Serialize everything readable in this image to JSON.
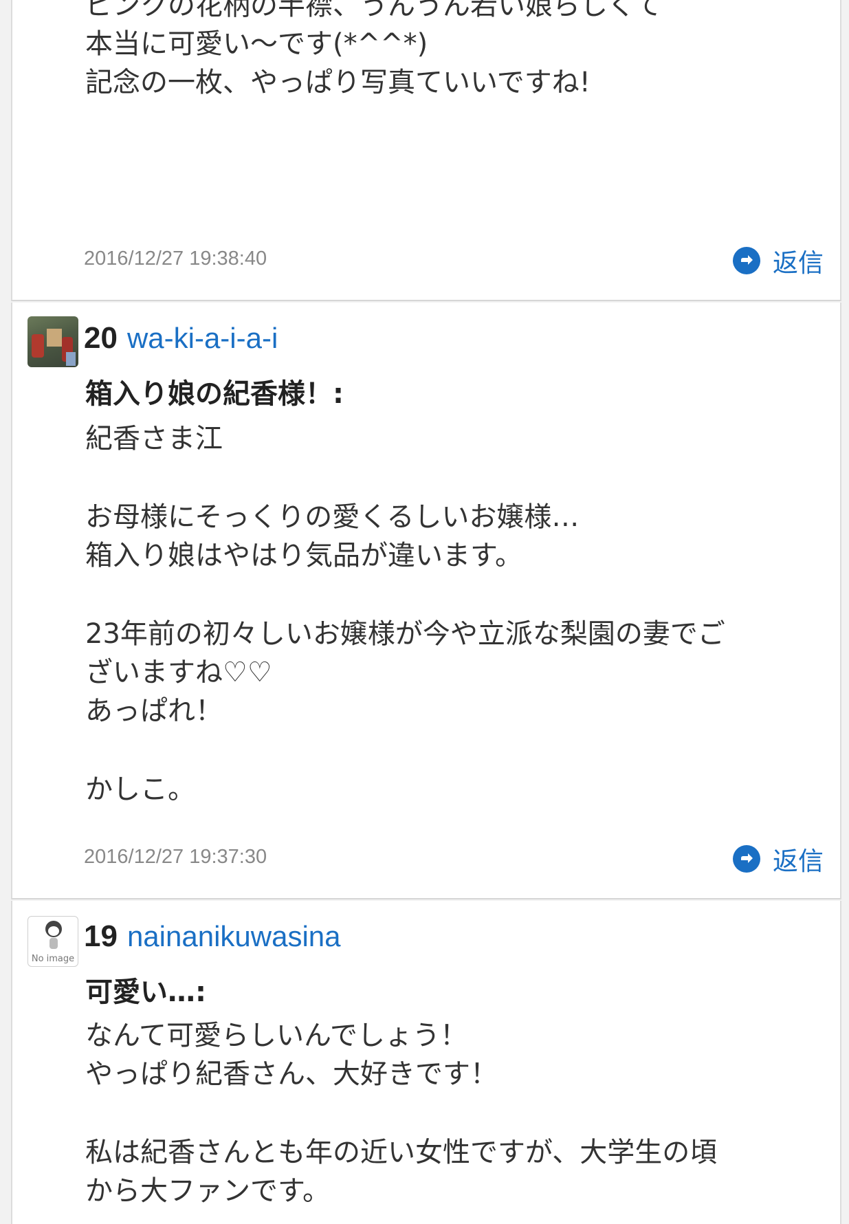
{
  "comments": [
    {
      "body_lines": [
        "ピンクの花柄の半襟、うんうん若い娘らしくて",
        "本当に可愛い〜です(*^^*)",
        "記念の一枚、やっぱり写真ていいですね!"
      ],
      "timestamp": "2016/12/27 19:38:40",
      "reply_label": "返信"
    },
    {
      "number": "20",
      "username": "wa-ki-a-i-a-i",
      "subject": "箱入り娘の紀香様！:",
      "body_lines": [
        "紀香さま江",
        "",
        "お母様にそっくりの愛くるしいお嬢様…",
        "箱入り娘はやはり気品が違います。",
        "",
        "23年前の初々しいお嬢様が今や立派な梨園の妻でご",
        "ざいますね♡♡",
        "あっぱれ！",
        "",
        "かしこ。"
      ],
      "timestamp": "2016/12/27 19:37:30",
      "reply_label": "返信"
    },
    {
      "number": "19",
      "username": "nainanikuwasina",
      "avatar_caption": "No image",
      "subject": "可愛い…:",
      "body_lines": [
        "なんて可愛らしいんでしょう！",
        "やっぱり紀香さん、大好きです！",
        "",
        "私は紀香さんとも年の近い女性ですが、大学生の頃",
        "から大ファンです。"
      ]
    }
  ],
  "colors": {
    "link": "#1a6fc4",
    "timestamp": "#888888",
    "background": "#f2f2f2"
  },
  "icons": {
    "reply": "arrow-circle-right-icon"
  }
}
